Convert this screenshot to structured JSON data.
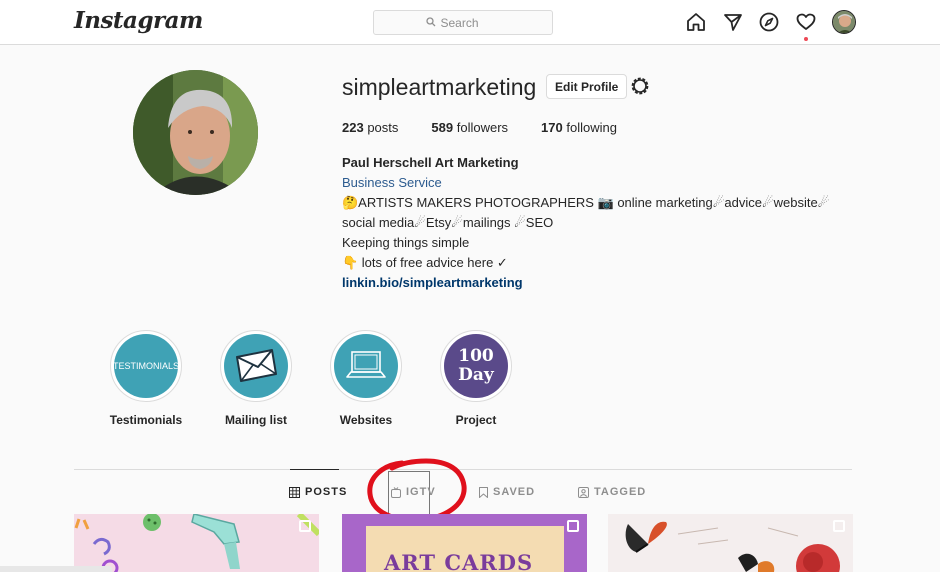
{
  "nav": {
    "logo": "Instagram",
    "search_placeholder": "Search",
    "icons": [
      "home-icon",
      "direct-icon",
      "explore-icon",
      "activity-icon",
      "profile-avatar"
    ]
  },
  "profile": {
    "username": "simpleartmarketing",
    "edit_label": "Edit Profile",
    "stats": [
      {
        "count": "223",
        "label": "posts"
      },
      {
        "count": "589",
        "label": "followers"
      },
      {
        "count": "170",
        "label": "following"
      }
    ],
    "bio": {
      "name": "Paul Herschell Art Marketing",
      "category": "Business Service",
      "line1": "🤔ARTISTS MAKERS PHOTOGRAPHERS 📷 online marketing☄advice☄website☄",
      "line2": "social media☄Etsy☄mailings ☄SEO",
      "line3": "Keeping things simple",
      "line4": "👇 lots of free advice here ✓",
      "link": "linkin.bio/simpleartmarketing"
    }
  },
  "highlights": [
    {
      "label": "Testimonials",
      "cover_text": "TESTIMONIALS",
      "color": "#3fa2b5"
    },
    {
      "label": "Mailing list",
      "color": "#3fa2b5"
    },
    {
      "label": "Websites",
      "color": "#3fa2b5"
    },
    {
      "label": "Project",
      "cover_text_1": "100",
      "cover_text_2": "Day",
      "color": "#5a4a8a"
    }
  ],
  "tabs": [
    {
      "label": "POSTS",
      "icon": "grid-icon",
      "active": true
    },
    {
      "label": "IGTV",
      "icon": "igtv-icon",
      "active": false
    },
    {
      "label": "SAVED",
      "icon": "bookmark-icon",
      "active": false
    },
    {
      "label": "TAGGED",
      "icon": "tagged-icon",
      "active": false
    }
  ],
  "posts": [
    {
      "title": "",
      "bg": "#f5dbe6"
    },
    {
      "title": "ART CARDS",
      "bg": "#a866c9"
    },
    {
      "title": "",
      "bg": "#f4eeee"
    }
  ],
  "colors": {
    "accent_link": "#00376b",
    "category": "#2c5b8f",
    "annotation": "#e0101c",
    "notification": "#ed4956"
  }
}
